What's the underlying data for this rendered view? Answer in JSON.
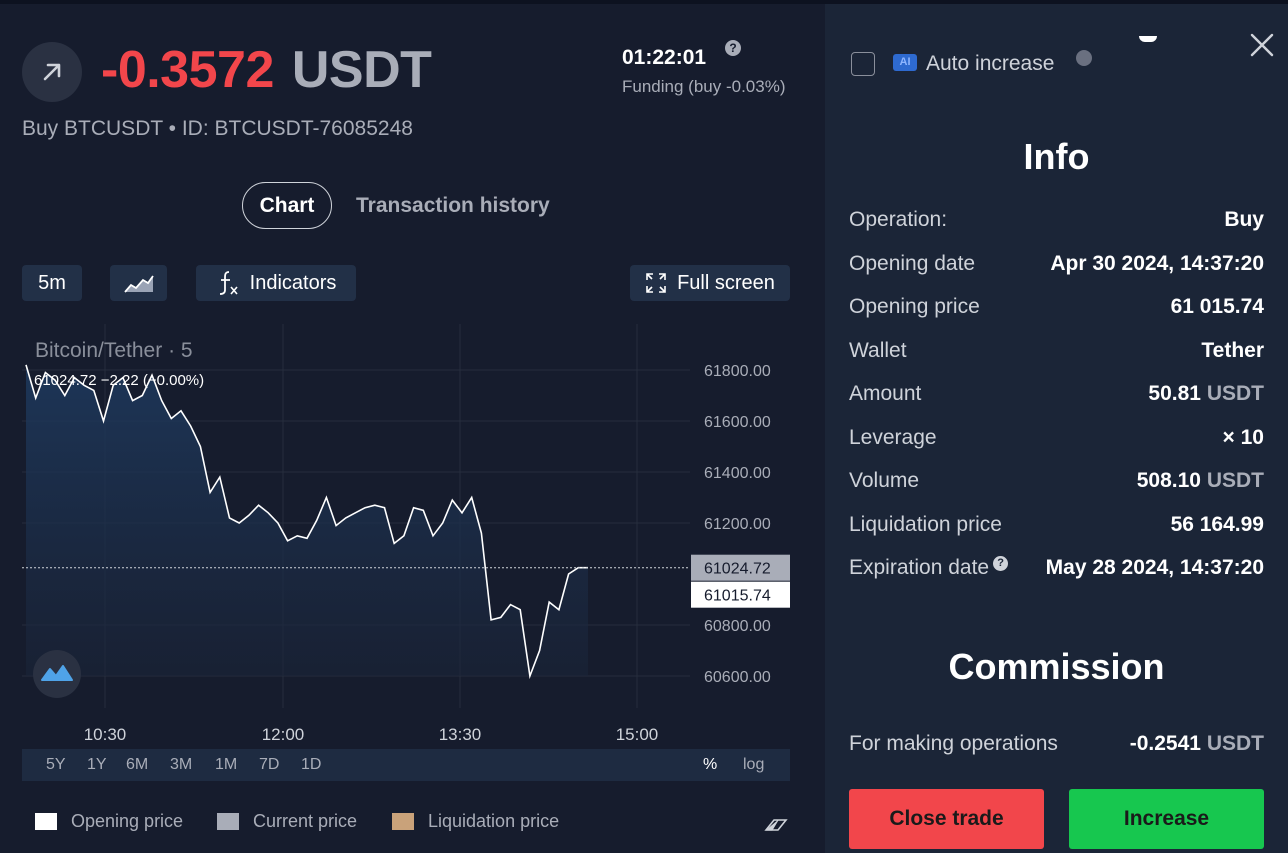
{
  "trade": {
    "pnl_value": "-0.3572",
    "pnl_currency": "USDT",
    "subtitle": "Buy BTCUSDT • ID: BTCUSDT-76085248",
    "timer": "01:22:01",
    "funding": "Funding (buy -0.03%)",
    "direction_icon": "arrow-up-right-icon"
  },
  "tabs": {
    "chart": "Chart",
    "history": "Transaction history"
  },
  "toolbar": {
    "interval": "5m",
    "indicators": "Indicators",
    "fullscreen": "Full screen"
  },
  "chart_data": {
    "type": "area",
    "title": "Bitcoin/Tether · 5",
    "info": "61024.72  −2.22 (−0.00%)",
    "x_labels": [
      "10:30",
      "12:00",
      "13:30",
      "15:00"
    ],
    "y_labels": [
      "61800.00",
      "61600.00",
      "61400.00",
      "61200.00",
      "60800.00",
      "60600.00"
    ],
    "ylim": [
      60500,
      61950
    ],
    "current_price": "61024.72",
    "opening_price": "61015.74",
    "current_value": 61024.72,
    "opening_value": 61015.74,
    "series": [
      {
        "values": [
          61820,
          61690,
          61790,
          61760,
          61700,
          61770,
          61740,
          61720,
          61600,
          61740,
          61770,
          61680,
          61700,
          61780,
          61680,
          61610,
          61640,
          61580,
          61500,
          61320,
          61380,
          61220,
          61200,
          61230,
          61270,
          61240,
          61200,
          61130,
          61150,
          61140,
          61210,
          61300,
          61190,
          61220,
          61240,
          61260,
          61270,
          61260,
          61120,
          61150,
          61260,
          61250,
          61150,
          61200,
          61290,
          61240,
          61300,
          61160,
          60820,
          60830,
          60880,
          60860,
          60600,
          60700,
          60890,
          60860,
          61000,
          61024.72,
          61024.72
        ]
      }
    ],
    "colors": {
      "line": "#ffffff",
      "fill": "#1e3a5f",
      "grid": "#262d3d"
    },
    "grid": true
  },
  "ranges": [
    "5Y",
    "1Y",
    "6M",
    "3M",
    "1M",
    "7D",
    "1D"
  ],
  "range_right": {
    "percent": "%",
    "log": "log"
  },
  "legend": [
    {
      "label": "Opening price",
      "color": "#ffffff"
    },
    {
      "label": "Current price",
      "color": "#a9adb8"
    },
    {
      "label": "Liquidation price",
      "color": "#c9a27a"
    }
  ],
  "side": {
    "auto_increase": "Auto increase",
    "ai_badge": "AI",
    "info_title": "Info",
    "commission_title": "Commission",
    "rows": [
      {
        "label": "Operation:",
        "value": "Buy",
        "unit": ""
      },
      {
        "label": "Opening date",
        "value": "Apr 30 2024, 14:37:20",
        "unit": ""
      },
      {
        "label": "Opening price",
        "value": "61 015.74",
        "unit": ""
      },
      {
        "label": "Wallet",
        "value": "Tether",
        "unit": ""
      },
      {
        "label": "Amount",
        "value": "50.81",
        "unit": "USDT"
      },
      {
        "label": "Leverage",
        "value": "× 10",
        "unit": ""
      },
      {
        "label": "Volume",
        "value": "508.10",
        "unit": "USDT"
      },
      {
        "label": "Liquidation price",
        "value": "56 164.99",
        "unit": ""
      },
      {
        "label": "Expiration date",
        "value": "May 28 2024, 14:37:20",
        "unit": ""
      }
    ],
    "commission": {
      "label": "For making operations",
      "value": "-0.2541",
      "unit": "USDT"
    },
    "close_button": "Close trade",
    "increase_button": "Increase"
  }
}
